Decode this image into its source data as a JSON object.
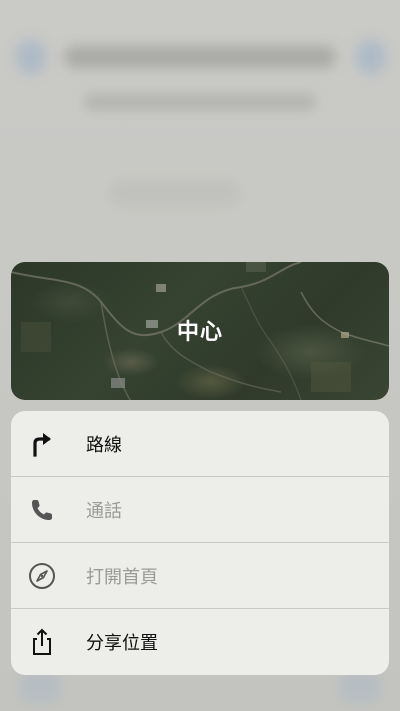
{
  "map_preview": {
    "label": "中心"
  },
  "menu": {
    "items": [
      {
        "label": "路線",
        "icon": "turn-right-arrow-icon",
        "enabled": true
      },
      {
        "label": "通話",
        "icon": "phone-icon",
        "enabled": false
      },
      {
        "label": "打開首頁",
        "icon": "compass-icon",
        "enabled": false
      },
      {
        "label": "分享位置",
        "icon": "share-icon",
        "enabled": true
      }
    ]
  },
  "colors": {
    "menu_background": "#ededea",
    "enabled_text": "#111111",
    "disabled_text": "#9a9a98",
    "map_label": "#ffffff"
  }
}
